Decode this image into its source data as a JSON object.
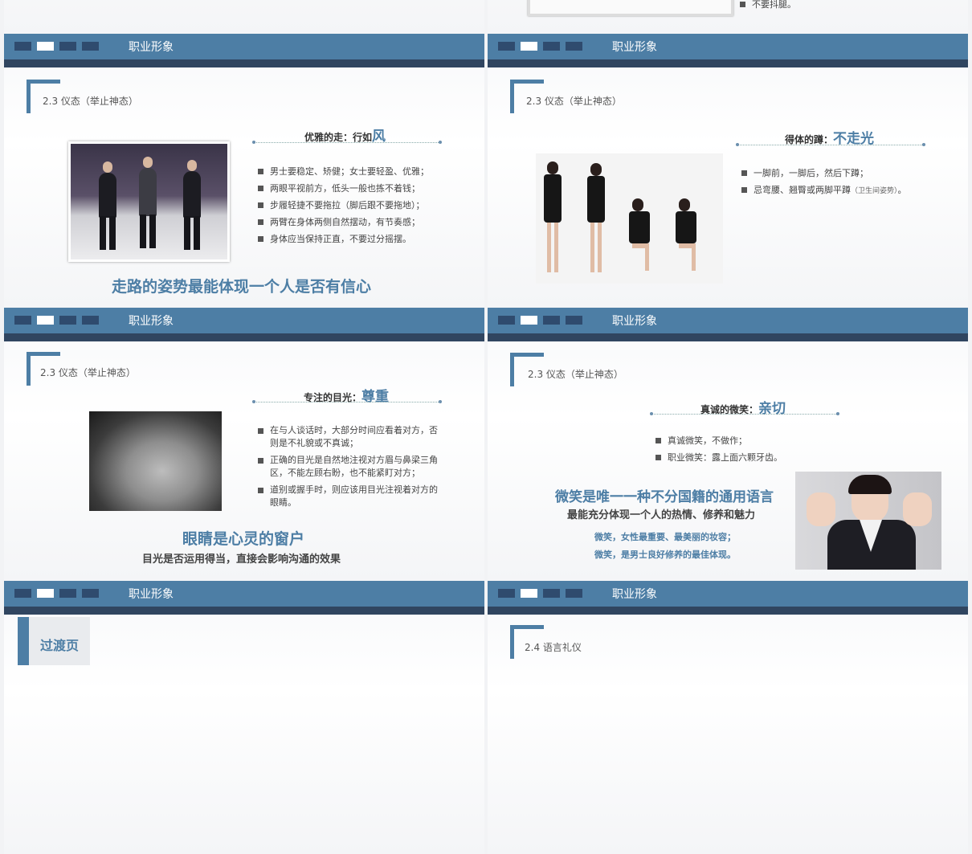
{
  "top_left": {},
  "top_right": {
    "bullet": "不要抖腿。"
  },
  "header_title": "职业形象",
  "section_label": "2.3  仪态（举止神态）",
  "slide_walk": {
    "heading_prefix": "优雅的走：行如",
    "heading_big": "风",
    "bullets": [
      "男士要稳定、矫健；女士要轻盈、优雅；",
      "两眼平视前方，低头一般也拣不着钱；",
      "步履轻捷不要拖拉（脚后跟不要拖地）；",
      "两臂在身体两侧自然摆动，有节奏感；",
      "身体应当保持正直，不要过分摇摆。"
    ],
    "tagline": "走路的姿势最能体现一个人是否有信心"
  },
  "slide_squat": {
    "heading_prefix": "得体的蹲：",
    "heading_big": "不走光",
    "bullets": [
      "一脚前，一脚后，然后下蹲；"
    ],
    "bullet2_main": "忌弯腰、翘臀或两脚平蹲",
    "bullet2_small": "（卫生间姿势）",
    "bullet2_end": "。"
  },
  "slide_gaze": {
    "heading_prefix": "专注的目光：",
    "heading_big": "尊重",
    "bullets": [
      "在与人谈话时，大部分时间应看着对方，否则是不礼貌或不真诚；",
      "正确的目光是自然地注视对方眉与鼻梁三角区，不能左顾右盼，也不能紧盯对方；",
      "道别或握手时，则应该用目光注视着对方的眼睛。"
    ],
    "tagline": "眼睛是心灵的窗户",
    "subline": "目光是否运用得当，直接会影响沟通的效果"
  },
  "slide_smile": {
    "heading_prefix": "真诚的微笑：",
    "heading_big": "亲切",
    "bullets": [
      "真诚微笑，不做作；",
      "职业微笑：露上面六颗牙齿。"
    ],
    "tagline": "微笑是唯一一种不分国籍的通用语言",
    "subline": "最能充分体现一个人的热情、修养和魅力",
    "note1": "微笑，女性最重要、最美丽的妆容；",
    "note2": "微笑，是男士良好修养的最佳体现。"
  },
  "bottom_left": {
    "label": "过渡页"
  },
  "bottom_right": {
    "section_label": "2.4  语言礼仪"
  },
  "colors": {
    "accent": "#4d7ea5",
    "dark": "#304560"
  }
}
